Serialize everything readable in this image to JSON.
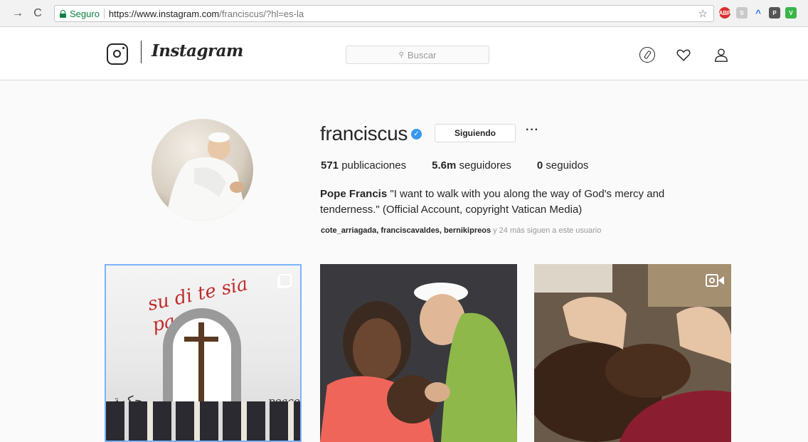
{
  "browser": {
    "secure_label": "Seguro",
    "url_host": "https://www.instagram.com",
    "url_path": "/franciscus/?hl=es-la",
    "extensions": [
      "ABP",
      "S",
      "^",
      "P",
      "V"
    ]
  },
  "header": {
    "wordmark": "Instagram",
    "search_placeholder": "Buscar"
  },
  "profile": {
    "username": "franciscus",
    "follow_label": "Siguiendo",
    "more_label": "···",
    "stats": {
      "posts_count": "571",
      "posts_label": "publicaciones",
      "followers_count": "5.6m",
      "followers_label": "seguidores",
      "following_count": "0",
      "following_label": "seguidos"
    },
    "bio_name": "Pope Francis",
    "bio_text": "\"I want to walk with you along the way of God's mercy and tenderness.\" (Official Account, copyright Vatican Media)",
    "followed_by_names": "cote_arriagada, franciscavaldes, bernikipreos",
    "followed_by_suffix": " y 24 más siguen a este usuario"
  },
  "posts": [
    {
      "type": "carousel",
      "mural_text": "su di te sia pace",
      "sign_text": "peace :",
      "script_text": "حكمة"
    },
    {
      "type": "photo"
    },
    {
      "type": "video"
    }
  ],
  "colors": {
    "verified": "#3897f0",
    "secure": "#0b8043",
    "selected_border": "#7cb3ff"
  }
}
